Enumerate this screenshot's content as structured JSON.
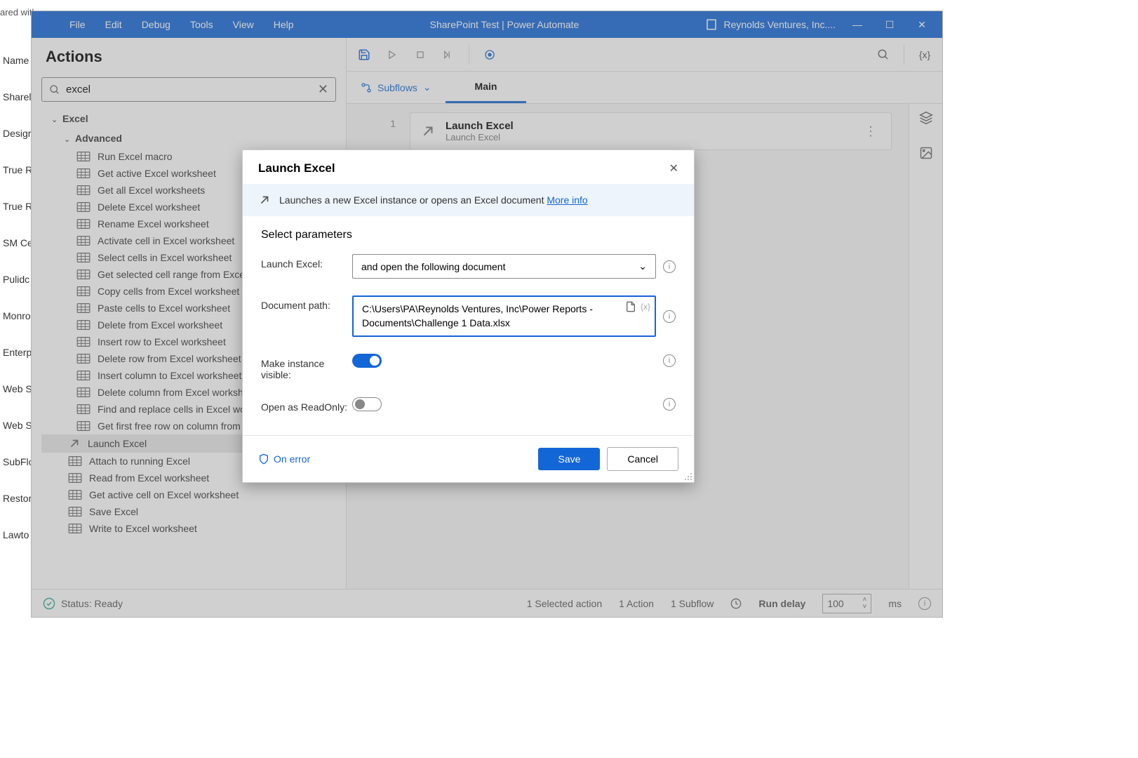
{
  "bg": {
    "shared_text": "ared with me",
    "labels": [
      "Name",
      "Sharel",
      "Desigr",
      "True R",
      "True R",
      "SM Ce",
      "Pulidc",
      "Monro",
      "Enterp",
      "Web S",
      "Web S",
      "SubFlc",
      "Restor",
      "Lawto"
    ]
  },
  "title_bar": {
    "menus": [
      "File",
      "Edit",
      "Debug",
      "Tools",
      "View",
      "Help"
    ],
    "title": "SharePoint Test | Power Automate",
    "org": "Reynolds Ventures, Inc...."
  },
  "actions_panel": {
    "header": "Actions",
    "search_value": "excel",
    "groups": {
      "excel": "Excel",
      "advanced": "Advanced"
    },
    "advanced_items": [
      "Run Excel macro",
      "Get active Excel worksheet",
      "Get all Excel worksheets",
      "Delete Excel worksheet",
      "Rename Excel worksheet",
      "Activate cell in Excel worksheet",
      "Select cells in Excel worksheet",
      "Get selected cell range from Excel wor",
      "Copy cells from Excel worksheet",
      "Paste cells to Excel worksheet",
      "Delete from Excel worksheet",
      "Insert row to Excel worksheet",
      "Delete row from Excel worksheet",
      "Insert column to Excel worksheet",
      "Delete column from Excel worksheet",
      "Find and replace cells in Excel workshe",
      "Get first free row on column from Exce"
    ],
    "excel_items": [
      "Launch Excel",
      "Attach to running Excel",
      "Read from Excel worksheet",
      "Get active cell on Excel worksheet",
      "Save Excel",
      "Write to Excel worksheet"
    ]
  },
  "tabs": {
    "subflows": "Subflows",
    "main": "Main"
  },
  "canvas": {
    "line1": "1",
    "card_title": "Launch Excel",
    "card_sub": "Launch Excel"
  },
  "status": {
    "ready": "Status: Ready",
    "selected": "1 Selected action",
    "actions": "1 Action",
    "subflows": "1 Subflow",
    "run_delay": "Run delay",
    "delay_value": "100",
    "ms": "ms"
  },
  "modal": {
    "title": "Launch Excel",
    "banner": "Launches a new Excel instance or opens an Excel document",
    "more_info": "More info",
    "section": "Select parameters",
    "labels": {
      "launch": "Launch Excel:",
      "path": "Document path:",
      "visible": "Make instance visible:",
      "readonly": "Open as ReadOnly:"
    },
    "launch_value": "and open the following document",
    "path_value": "C:\\Users\\PA\\Reynolds Ventures, Inc\\Power Reports - Documents\\Challenge 1 Data.xlsx",
    "on_error": "On error",
    "save": "Save",
    "cancel": "Cancel"
  },
  "vars_symbol": "{x}"
}
